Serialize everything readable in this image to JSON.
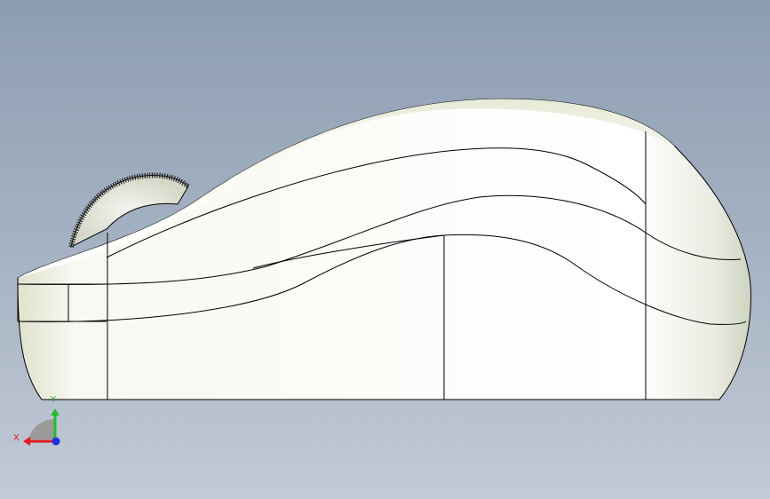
{
  "viewport": {
    "background_top": "#8d9db1",
    "background_bottom": "#c2cad5"
  },
  "model": {
    "description_icon": "computer-mouse-side-view",
    "body_color": "#ffffff",
    "edge_color": "#000000",
    "shade_color": "#d9dcc8"
  },
  "triad": {
    "x_label": "X",
    "y_label": "Y",
    "x_color": "#e01b1b",
    "y_color": "#1fbf2a",
    "z_color": "#1b2fe0"
  }
}
